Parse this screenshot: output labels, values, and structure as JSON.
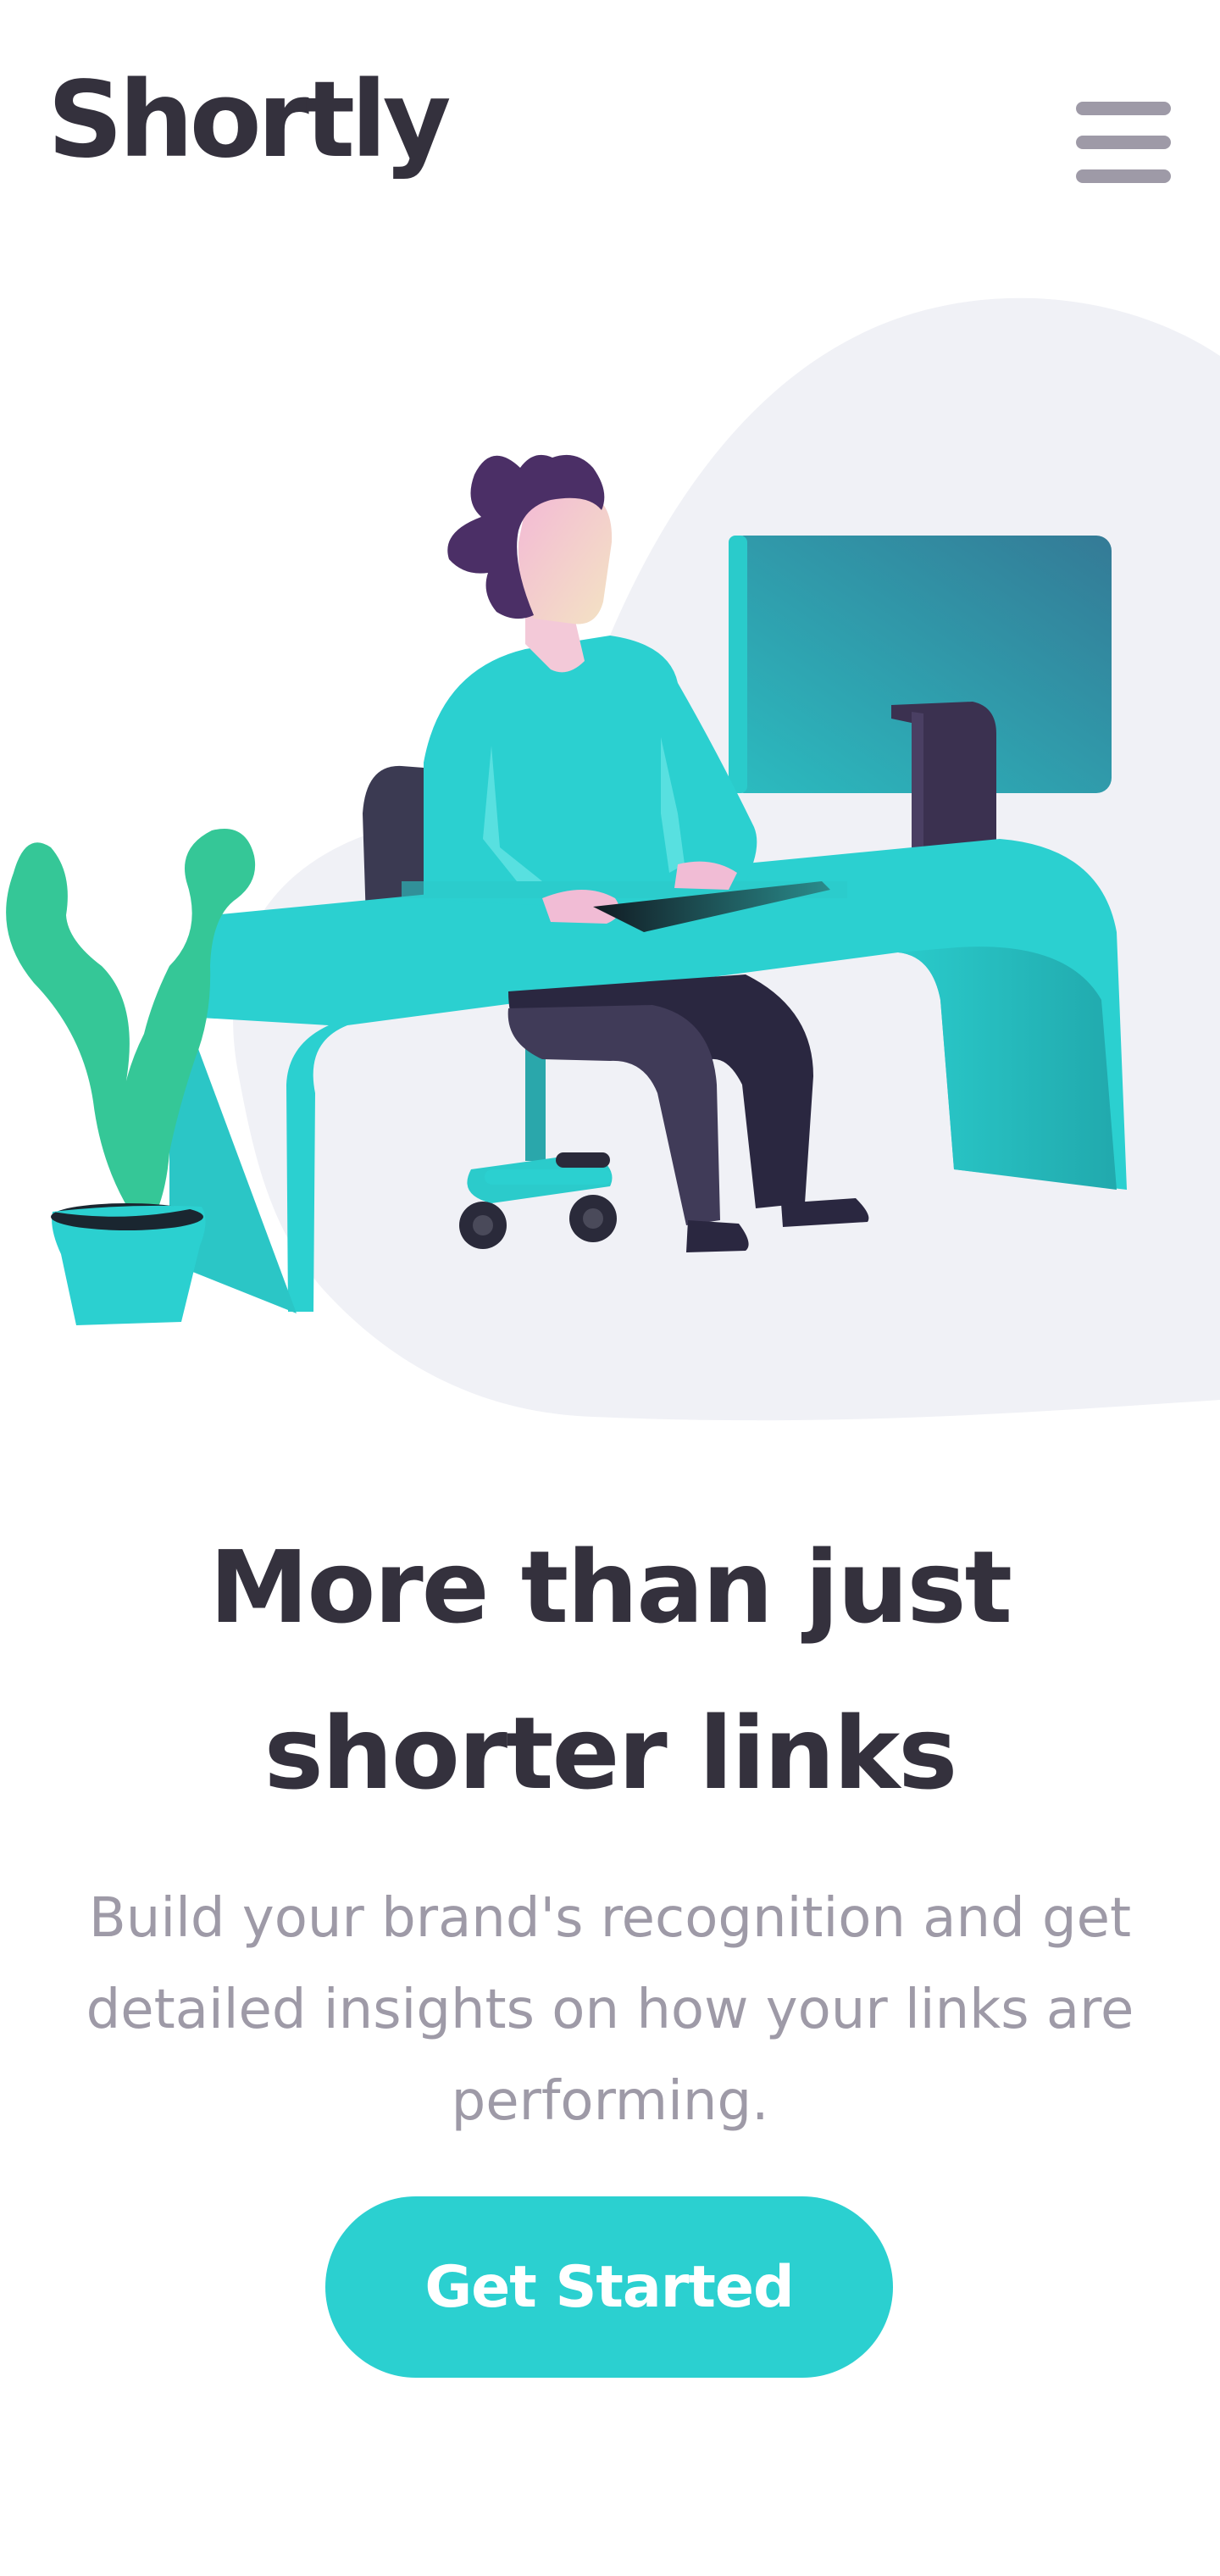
{
  "header": {
    "logo": "Shortly",
    "menu_icon": "hamburger-menu-icon"
  },
  "hero": {
    "illustration": "person-working-at-desk-illustration",
    "headline": "More than just shorter links",
    "subtext": "Build your brand's recognition and get detailed insights on how your links are performing.",
    "cta_label": "Get Started"
  },
  "colors": {
    "primary": "#2bd0d0",
    "dark_text": "#34313d",
    "gray_text": "#9e9aa7",
    "blob_bg": "#f0f1f6",
    "plant_green": "#35c797",
    "hair_purple": "#4b2f66"
  }
}
